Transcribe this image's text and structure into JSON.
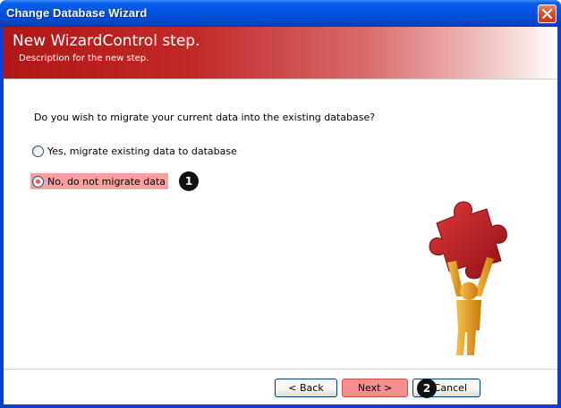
{
  "window": {
    "title": "Change Database Wizard"
  },
  "banner": {
    "title": "New WizardControl step.",
    "description": "Description for the new step."
  },
  "step": {
    "question": "Do you wish to migrate your current data into the existing database?",
    "options": [
      {
        "label": "Yes, migrate existing data to database",
        "selected": false
      },
      {
        "label": "No, do not migrate data",
        "selected": true
      }
    ]
  },
  "callouts": [
    "1",
    "2"
  ],
  "buttons": {
    "back": "< Back",
    "next": "Next >",
    "cancel": "Cancel"
  },
  "colors": {
    "titlebar": "#0054e3",
    "banner": "#b01818",
    "highlight": "#f7a0a0",
    "puzzle": "#c21d22",
    "figure": "#e8a11c"
  },
  "icons": [
    "close-icon",
    "puzzle-figure-illustration"
  ]
}
